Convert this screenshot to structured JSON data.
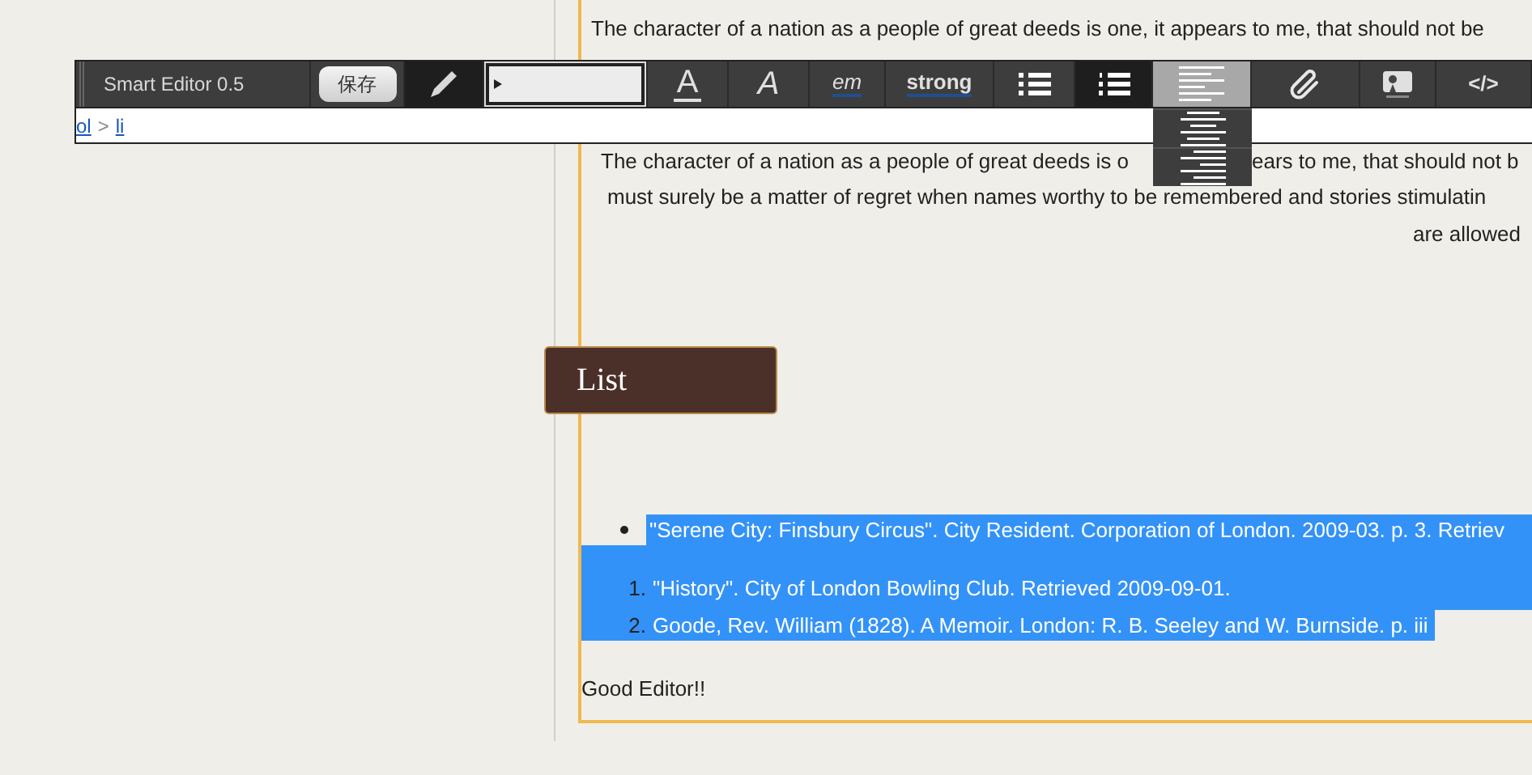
{
  "toolbar": {
    "title": "Smart Editor 0.5",
    "save_label": "保存",
    "tools": [
      {
        "kind": "pencil",
        "selected": true
      },
      {
        "kind": "field",
        "selected": false
      },
      {
        "kind": "color",
        "label": "A",
        "selected": false
      },
      {
        "kind": "italic",
        "label": "A",
        "selected": false
      },
      {
        "kind": "em",
        "label": "em",
        "selected": false
      },
      {
        "kind": "strong",
        "label": "strong",
        "selected": false
      },
      {
        "kind": "bullets",
        "selected": false
      },
      {
        "kind": "numbers",
        "selected": true
      },
      {
        "kind": "align",
        "selected": true,
        "expanded": true,
        "options": [
          {
            "kind": "center"
          },
          {
            "kind": "right"
          }
        ]
      },
      {
        "kind": "link",
        "selected": false
      },
      {
        "kind": "image",
        "selected": false
      },
      {
        "kind": "code",
        "label": "</>",
        "selected": false
      }
    ]
  },
  "breadcrumb": {
    "items": [
      "ol",
      "li"
    ],
    "separator": ">"
  },
  "editor": {
    "paragraphs": [
      {
        "lines": [
          {
            "parts": [
              "The character of a nation as a people of great deeds is one, it appears to me, that should not be"
            ]
          }
        ]
      },
      {
        "lines": [
          {
            "parts": [
              "The character of a nation as a people of great deeds is o",
              "ears to me, that should not b"
            ]
          },
          {
            "parts": [
              "must surely be a matter of regret when names worthy to be remembered and stories stimulatin"
            ]
          }
        ],
        "end_line": "are allowed"
      }
    ],
    "badge": "List",
    "bullet_items": [
      {
        "text": "\"Serene City: Finsbury Circus\". City Resident. Corporation of London. 2009-03. p. 3. Retriev",
        "selected": true
      }
    ],
    "numbered_items": [
      {
        "number": "1.",
        "text": "\"History\". City of London Bowling Club. Retrieved 2009-09-01.",
        "selected": true
      },
      {
        "number": "2.",
        "text": "Goode, Rev. William (1828). A Memoir. London: R. B. Seeley and W. Burnside. p. iii",
        "selected": true
      }
    ],
    "footer": "Good Editor!!"
  }
}
